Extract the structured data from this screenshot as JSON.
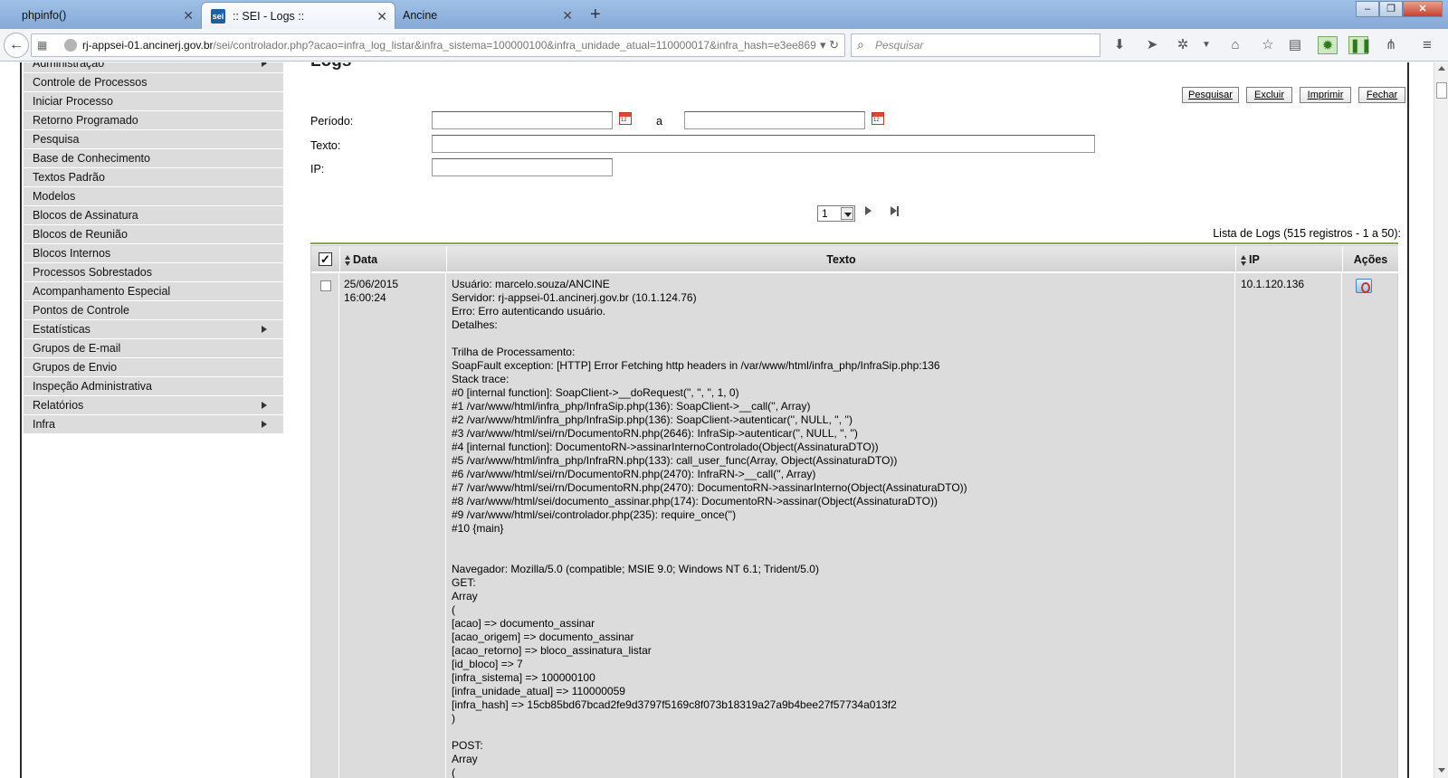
{
  "browser": {
    "tabs": [
      {
        "label": "phpinfo()",
        "active": false
      },
      {
        "label": ":: SEI - Logs ::",
        "active": true,
        "favicon": "sei"
      },
      {
        "label": "Ancine",
        "active": false
      }
    ],
    "new_tab_symbol": "+",
    "window_buttons": {
      "minimize": "‒",
      "restore": "❐",
      "close": "✕"
    },
    "url_host": "rj-appsei-01.ancinerj.gov.br",
    "url_rest": "/sei/controlador.php?acao=infra_log_listar&infra_sistema=100000100&infra_unidade_atual=110000017&infra_hash=e3ee869",
    "search_placeholder": "Pesquisar"
  },
  "sidebar": {
    "items": [
      {
        "label": "Administração",
        "submenu": true
      },
      {
        "label": "Controle de Processos",
        "submenu": false
      },
      {
        "label": "Iniciar Processo",
        "submenu": false
      },
      {
        "label": "Retorno Programado",
        "submenu": false
      },
      {
        "label": "Pesquisa",
        "submenu": false
      },
      {
        "label": "Base de Conhecimento",
        "submenu": false
      },
      {
        "label": "Textos Padrão",
        "submenu": false
      },
      {
        "label": "Modelos",
        "submenu": false
      },
      {
        "label": "Blocos de Assinatura",
        "submenu": false
      },
      {
        "label": "Blocos de Reunião",
        "submenu": false
      },
      {
        "label": "Blocos Internos",
        "submenu": false
      },
      {
        "label": "Processos Sobrestados",
        "submenu": false
      },
      {
        "label": "Acompanhamento Especial",
        "submenu": false
      },
      {
        "label": "Pontos de Controle",
        "submenu": false
      },
      {
        "label": "Estatísticas",
        "submenu": true
      },
      {
        "label": "Grupos de E-mail",
        "submenu": false
      },
      {
        "label": "Grupos de Envio",
        "submenu": false
      },
      {
        "label": "Inspeção Administrativa",
        "submenu": false
      },
      {
        "label": "Relatórios",
        "submenu": true
      },
      {
        "label": "Infra",
        "submenu": true
      }
    ]
  },
  "main": {
    "title": "Logs",
    "buttons": {
      "pesquisar": "Pesquisar",
      "excluir": "Excluir",
      "imprimir": "Imprimir",
      "fechar": "Fechar"
    },
    "filters": {
      "periodo_label": "Período:",
      "periodo_sep": "a",
      "periodo_from": "",
      "periodo_to": "",
      "texto_label": "Texto:",
      "texto_value": "",
      "ip_label": "IP:",
      "ip_value": ""
    },
    "pager": {
      "current_page": "1"
    },
    "caption": "Lista de Logs (515 registros - 1 a 50):",
    "table": {
      "headers": {
        "check": "✓",
        "data": "Data",
        "texto": "Texto",
        "ip": "IP",
        "acoes": "Ações"
      },
      "rows": [
        {
          "data": "25/06/2015\n16:00:24",
          "ip": "10.1.120.136",
          "texto": "Usuário: marcelo.souza/ANCINE\nServidor: rj-appsei-01.ancinerj.gov.br (10.1.124.76)\nErro: Erro autenticando usuário.\nDetalhes:\n\nTrilha de Processamento:\nSoapFault exception: [HTTP] Error Fetching http headers in /var/www/html/infra_php/InfraSip.php:136\nStack trace:\n#0 [internal function]: SoapClient->__doRequest('', '', '', 1, 0)\n#1 /var/www/html/infra_php/InfraSip.php(136): SoapClient->__call('', Array)\n#2 /var/www/html/infra_php/InfraSip.php(136): SoapClient->autenticar('', NULL, '', '')\n#3 /var/www/html/sei/rn/DocumentoRN.php(2646): InfraSip->autenticar('', NULL, '', '')\n#4 [internal function]: DocumentoRN->assinarInternoControlado(Object(AssinaturaDTO))\n#5 /var/www/html/infra_php/InfraRN.php(133): call_user_func(Array, Object(AssinaturaDTO))\n#6 /var/www/html/sei/rn/DocumentoRN.php(2470): InfraRN->__call('', Array)\n#7 /var/www/html/sei/rn/DocumentoRN.php(2470): DocumentoRN->assinarInterno(Object(AssinaturaDTO))\n#8 /var/www/html/sei/documento_assinar.php(174): DocumentoRN->assinar(Object(AssinaturaDTO))\n#9 /var/www/html/sei/controlador.php(235): require_once('')\n#10 {main}\n\n\nNavegador: Mozilla/5.0 (compatible; MSIE 9.0; Windows NT 6.1; Trident/5.0)\nGET:\nArray\n(\n[acao] => documento_assinar\n[acao_origem] => documento_assinar\n[acao_retorno] => bloco_assinatura_listar\n[id_bloco] => 7\n[infra_sistema] => 100000100\n[infra_unidade_atual] => 110000059\n[infra_hash] => 15cb85bd67bcad2fe9d3797f5169c8f073b18319a27a9b4bee27f57734a013f2\n)\n\nPOST:\nArray\n("
        }
      ]
    }
  }
}
